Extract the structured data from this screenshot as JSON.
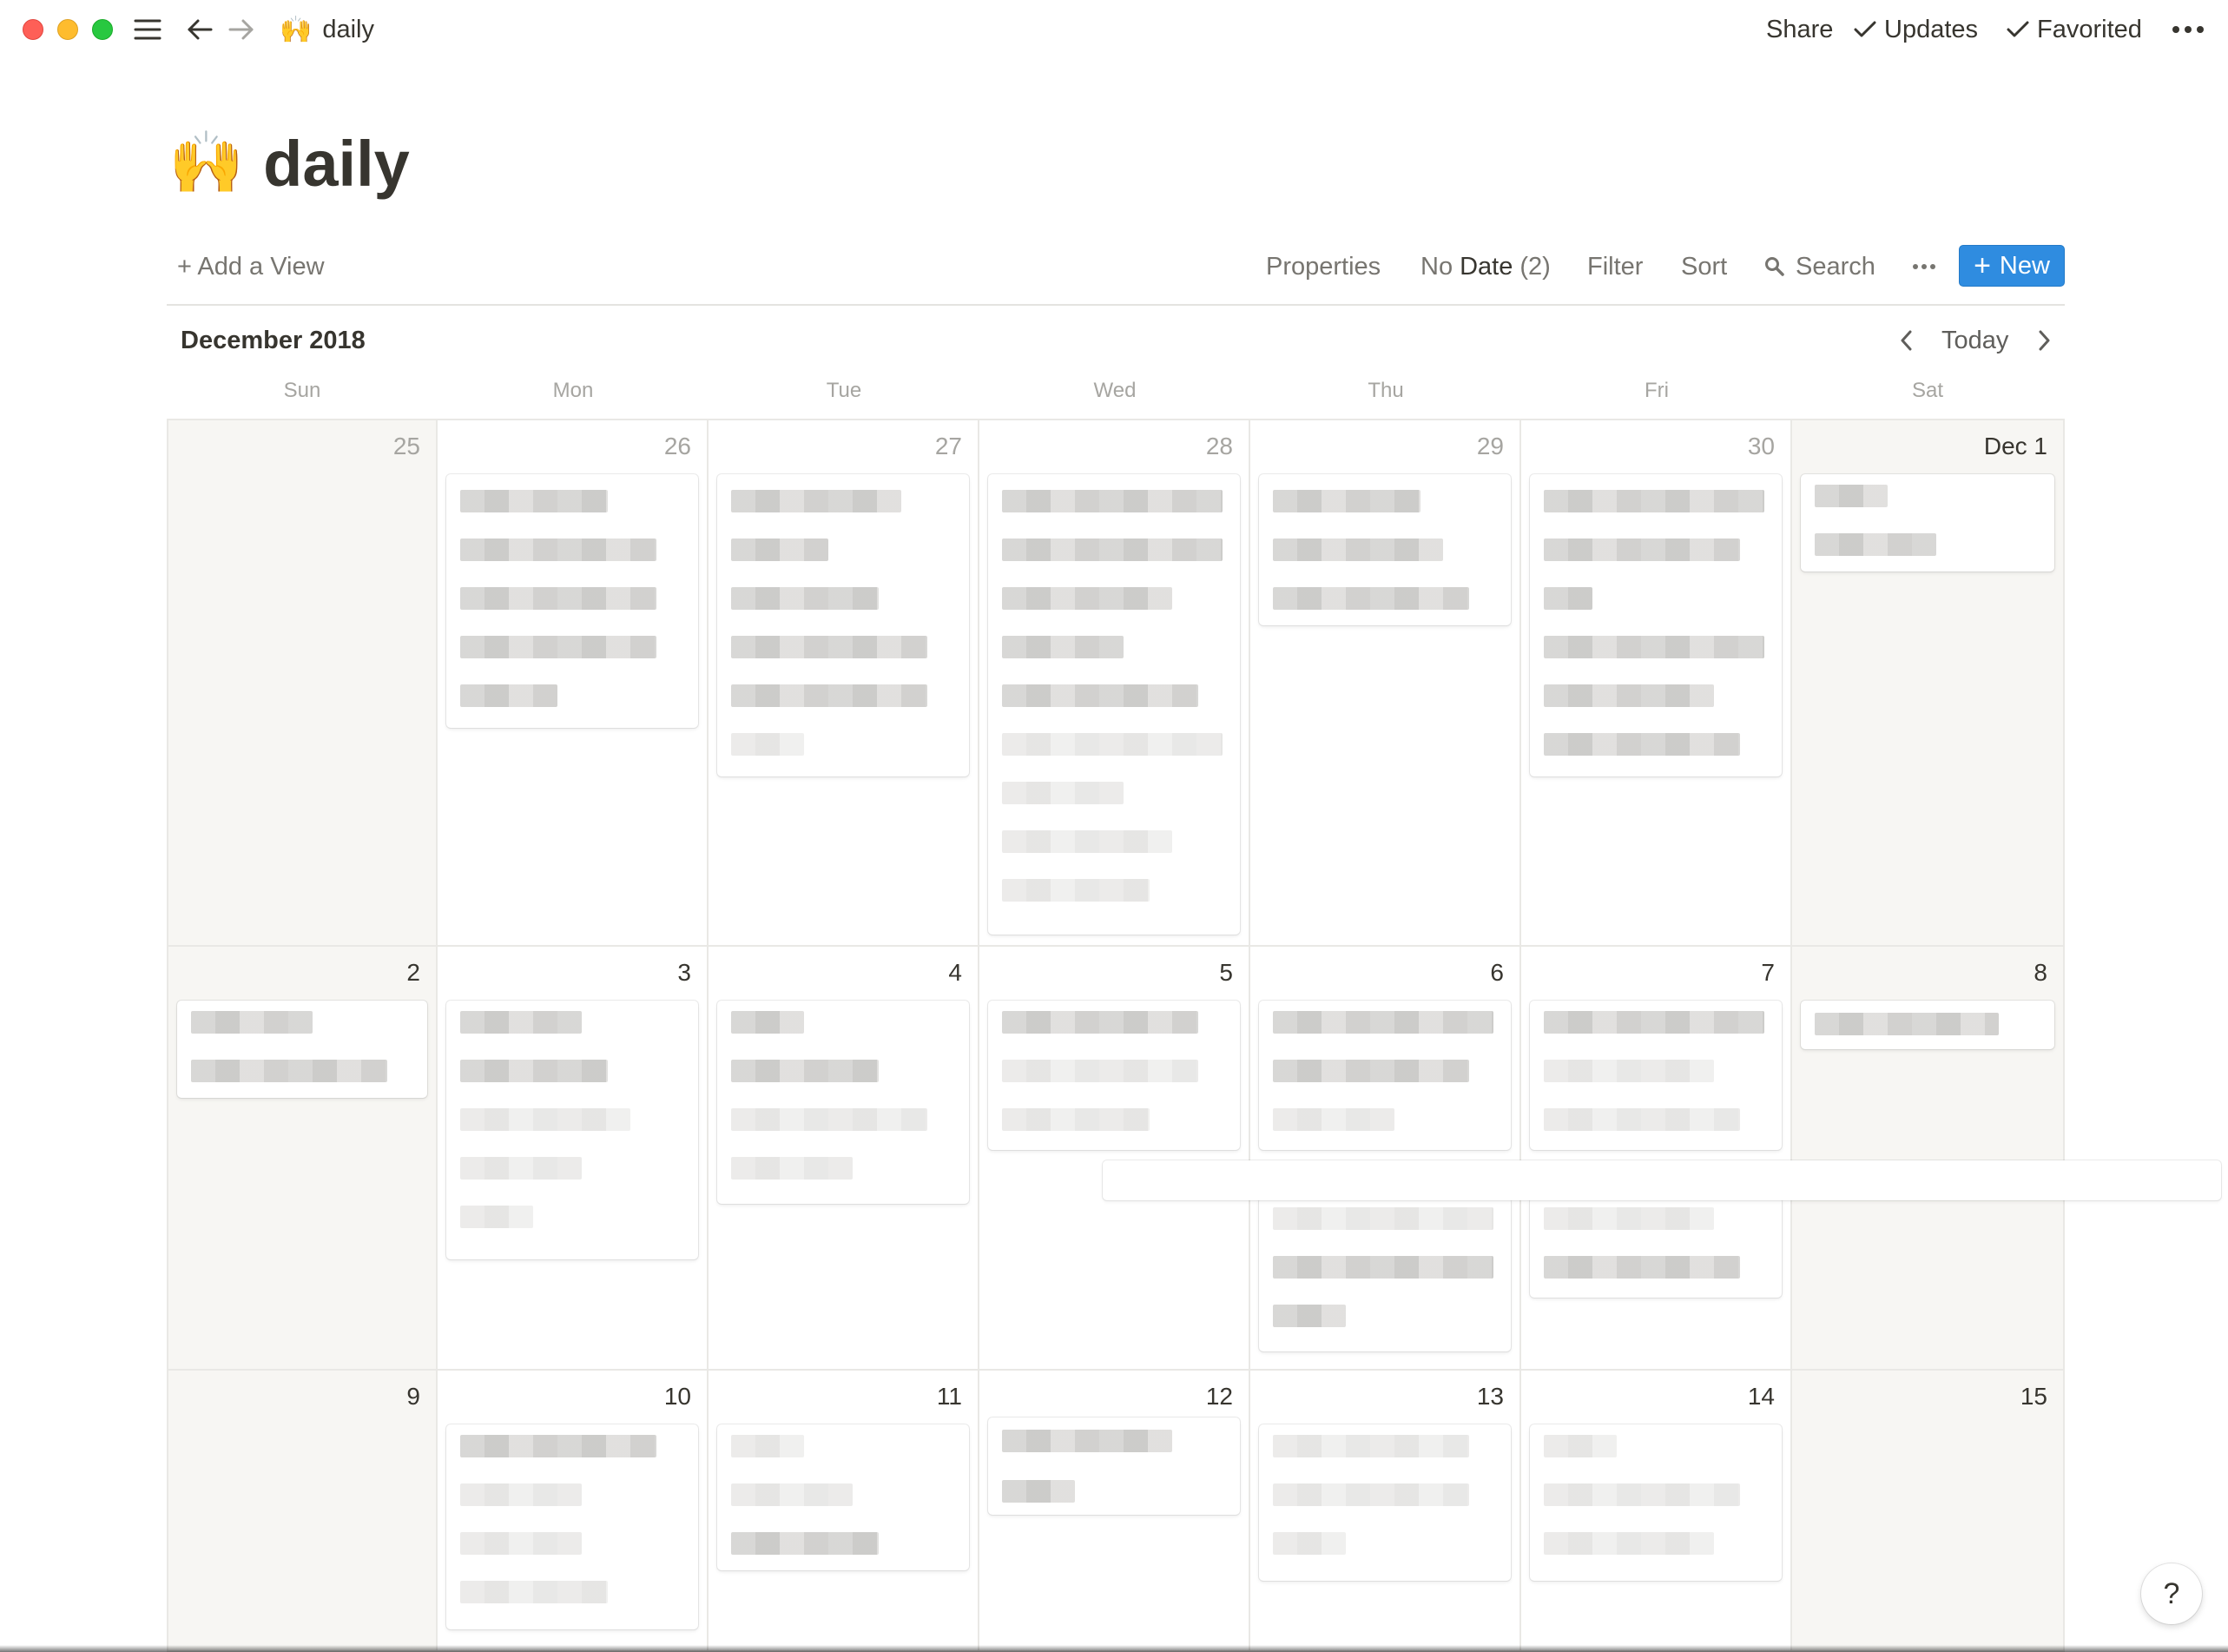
{
  "window": {
    "title": "daily",
    "title_emoji": "🙌",
    "share_label": "Share",
    "updates_label": "Updates",
    "favorited_label": "Favorited",
    "more_icon": "more-horizontal-icon"
  },
  "page": {
    "title": "daily",
    "emoji": "🙌"
  },
  "view_bar": {
    "add_view": "+ Add a View",
    "properties": "Properties",
    "no_date_prefix": "No",
    "no_date_field": "Date",
    "no_date_count": "(2)",
    "filter": "Filter",
    "sort": "Sort",
    "search": "Search",
    "new_label": "New",
    "accent_color": "#2f8ce0"
  },
  "calendar": {
    "month_label": "December 2018",
    "today_label": "Today",
    "weekdays": [
      "Sun",
      "Mon",
      "Tue",
      "Wed",
      "Thu",
      "Fri",
      "Sat"
    ],
    "weeks": [
      [
        "25",
        "26",
        "27",
        "28",
        "29",
        "30",
        "Dec 1"
      ],
      [
        "2",
        "3",
        "4",
        "5",
        "6",
        "7",
        "8"
      ],
      [
        "9",
        "10",
        "11",
        "12",
        "13",
        "14",
        "15"
      ]
    ]
  },
  "help": {
    "label": "?"
  }
}
